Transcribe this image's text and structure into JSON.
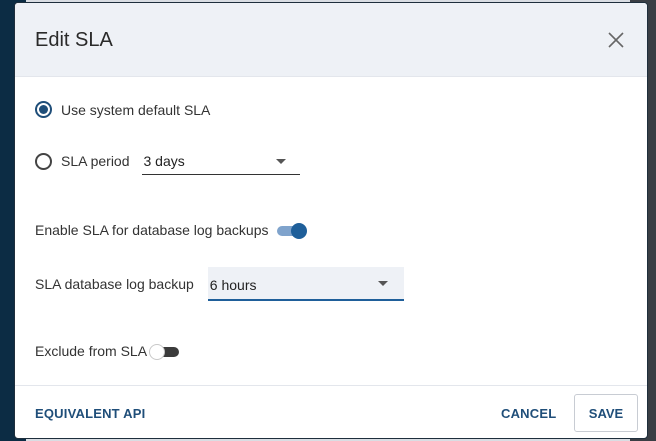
{
  "dialog": {
    "title": "Edit SLA",
    "close_icon": "close-icon"
  },
  "sla_option": {
    "default_label": "Use system default SLA",
    "default_selected": true,
    "period_label": "SLA period",
    "period_selected": false,
    "period_value": "3 days"
  },
  "db_log": {
    "enable_label": "Enable SLA for database log backups",
    "enable_on": true,
    "backup_label": "SLA database log backup",
    "backup_value": "6 hours"
  },
  "exclude": {
    "label": "Exclude from SLA",
    "on": false
  },
  "footer": {
    "equivalent_api": "EQUIVALENT API",
    "cancel": "CANCEL",
    "save": "SAVE"
  },
  "colors": {
    "accent": "#1f4e79",
    "header_bg": "#eef1f6",
    "toggle_on_track": "#7fa3cc",
    "toggle_on_thumb": "#1f5f9a"
  }
}
